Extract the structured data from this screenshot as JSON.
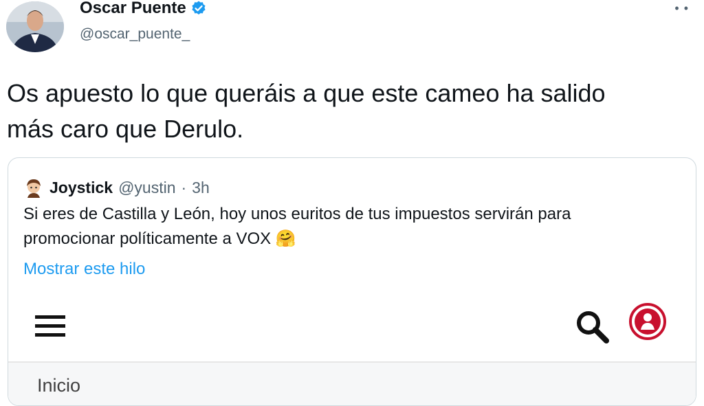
{
  "author": {
    "name": "Oscar Puente",
    "handle": "@oscar_puente_",
    "verified": true
  },
  "tweet": {
    "text_line1": "Os apuesto lo que queráis a que este cameo ha salido",
    "text_line2": "más caro que Derulo."
  },
  "quote": {
    "name": "Joystick",
    "handle": "@yustin",
    "separator": "·",
    "time": "3h",
    "text_line1": "Si eres de Castilla y León, hoy unos euritos de tus impuestos servirán para",
    "text_line2": "promocionar políticamente a VOX",
    "emoji": "🤗",
    "show_thread": "Mostrar este hilo"
  },
  "embed": {
    "nav_label": "Inicio"
  },
  "colors": {
    "link": "#1d9bf0",
    "secondary_text": "#536471",
    "verified_badge": "#1d9bf0",
    "user_icon": "#c8102e"
  },
  "icons": [
    "verified-badge-icon",
    "more-icon",
    "menu-icon",
    "search-icon",
    "user-icon"
  ]
}
